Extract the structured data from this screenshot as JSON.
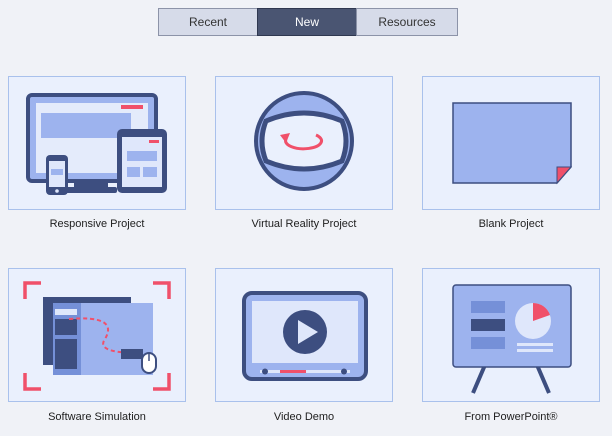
{
  "tabs": [
    {
      "label": "Recent",
      "active": false
    },
    {
      "label": "New",
      "active": true
    },
    {
      "label": "Resources",
      "active": false
    }
  ],
  "projects": [
    {
      "label": "Responsive Project",
      "icon": "devices-icon"
    },
    {
      "label": "Virtual Reality Project",
      "icon": "vr-headset-icon"
    },
    {
      "label": "Blank Project",
      "icon": "blank-page-icon"
    },
    {
      "label": "Software Simulation",
      "icon": "screen-capture-icon"
    },
    {
      "label": "Video Demo",
      "icon": "video-player-icon"
    },
    {
      "label": "From PowerPoint®",
      "icon": "presentation-board-icon"
    }
  ],
  "colors": {
    "background": "#f0f2f7",
    "card_fill": "#eaf0fd",
    "card_border": "#a9c1ec",
    "tab_active": "#4a5572",
    "tab_inactive": "#d6dbe9",
    "icon_dark": "#3d4e80",
    "icon_light": "#9db3ee",
    "accent": "#f0506a"
  }
}
